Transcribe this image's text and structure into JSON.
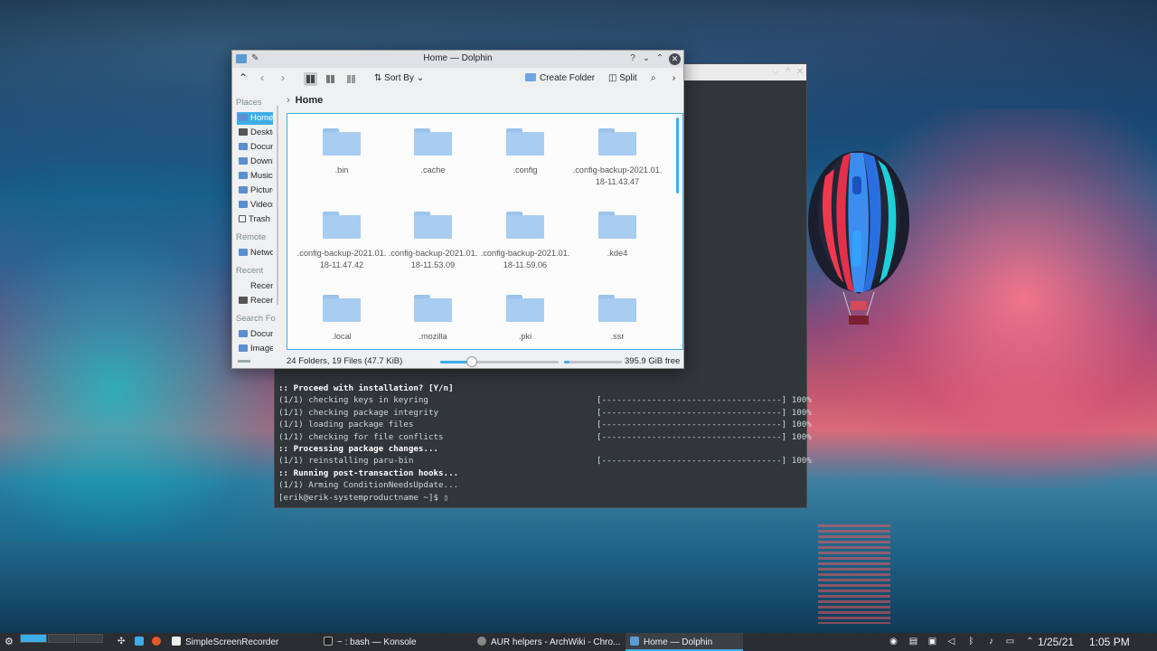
{
  "colors": {
    "accent": "#3daee9",
    "taskbar": "#2a2e32",
    "terminal_bg": "#31363b"
  },
  "dolphin": {
    "title": "Home — Dolphin",
    "toolbar": {
      "sort_by": "Sort By",
      "create_folder": "Create Folder",
      "split": "Split"
    },
    "sidebar": {
      "places_head": "Places",
      "places": [
        "Home",
        "Desktop",
        "Documents",
        "Downloads",
        "Music",
        "Pictures",
        "Videos",
        "Trash"
      ],
      "remote_head": "Remote",
      "remote": [
        "Network"
      ],
      "recent_head": "Recent",
      "recent": [
        "Recent Files",
        "Recent Locations"
      ],
      "search_head": "Search For",
      "search": [
        "Documents",
        "Images"
      ]
    },
    "breadcrumb": "Home",
    "items": [
      ".bin",
      ".cache",
      ".config",
      ".config-backup-2021.01.18-11.43.47",
      ".config-backup-2021.01.18-11.47.42",
      ".config-backup-2021.01.18-11.53.09",
      ".config-backup-2021.01.18-11.59.06",
      ".kde4",
      ".local",
      ".mozilla",
      ".pki",
      ".ssr"
    ],
    "status": "24 Folders, 19 Files (47.7 KiB)",
    "zoom_fraction": 0.27,
    "disk_used_fraction": 0.1,
    "free_space": "395.9 GiB free"
  },
  "konsole": {
    "lines": [
      {
        "text": ":: Proceed with installation? [Y/n]",
        "bold": true,
        "bar": ""
      },
      {
        "text": "(1/1) checking keys in keyring",
        "bold": false,
        "bar": "[------------------------------------] 100%"
      },
      {
        "text": "(1/1) checking package integrity",
        "bold": false,
        "bar": "[------------------------------------] 100%"
      },
      {
        "text": "(1/1) loading package files",
        "bold": false,
        "bar": "[------------------------------------] 100%"
      },
      {
        "text": "(1/1) checking for file conflicts",
        "bold": false,
        "bar": "[------------------------------------] 100%"
      },
      {
        "text": ":: Processing package changes...",
        "bold": true,
        "bar": ""
      },
      {
        "text": "(1/1) reinstalling paru-bin",
        "bold": false,
        "bar": "[------------------------------------] 100%"
      },
      {
        "text": ":: Running post-transaction hooks...",
        "bold": true,
        "bar": ""
      },
      {
        "text": "(1/1) Arming ConditionNeedsUpdate...",
        "bold": false,
        "bar": ""
      },
      {
        "text": "[erik@erik-systemproductname ~]$ ▯",
        "bold": false,
        "bar": ""
      }
    ]
  },
  "taskbar": {
    "tasks": [
      "SimpleScreenRecorder",
      "~ : bash — Konsole",
      "AUR helpers - ArchWiki - Chro...",
      "Home — Dolphin"
    ],
    "date": "1/25/21",
    "time": "1:05 PM"
  }
}
